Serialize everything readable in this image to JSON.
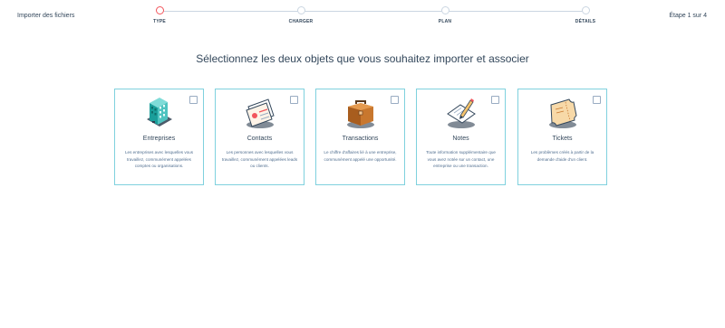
{
  "header": {
    "title": "Importer des fichiers",
    "step_indicator": "Étape 1 sur 4"
  },
  "steps": [
    {
      "label": "TYPE",
      "active": true
    },
    {
      "label": "CHARGER",
      "active": false
    },
    {
      "label": "PLAN",
      "active": false
    },
    {
      "label": "DÉTAILS",
      "active": false
    }
  ],
  "heading": "Sélectionnez les deux objets que vous souhaitez importer et associer",
  "cards": [
    {
      "title": "Entreprises",
      "icon": "building-icon",
      "selected": false,
      "description": "Les entreprises avec lesquelles vous travaillez, communément appelées comptes ou organisations."
    },
    {
      "title": "Contacts",
      "icon": "contact-cards-icon",
      "selected": false,
      "description": "Les personnes avec lesquelles vous travaillez, communément appelées leads ou clients."
    },
    {
      "title": "Transactions",
      "icon": "briefcase-icon",
      "selected": false,
      "description": "Le chiffre d'affaires lié à une entreprise, communément appelé une opportunité."
    },
    {
      "title": "Notes",
      "icon": "note-pencil-icon",
      "selected": false,
      "description": "Toute information supplémentaire que vous avez notée sur un contact, une entreprise ou une transaction."
    },
    {
      "title": "Tickets",
      "icon": "ticket-icon",
      "selected": false,
      "description": "Les problèmes créés à partir de la demande d'aide d'un client."
    }
  ],
  "colors": {
    "accent": "#f2545b",
    "card_border": "#7fd1de",
    "text": "#33475b"
  }
}
